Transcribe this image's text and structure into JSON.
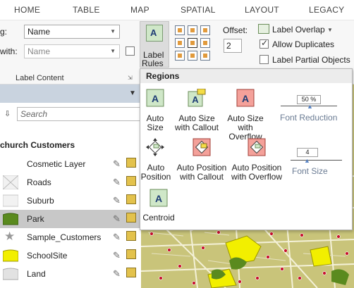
{
  "ribbon_tabs": [
    "HOME",
    "TABLE",
    "MAP",
    "SPATIAL",
    "LAYOUT",
    "LEGACY"
  ],
  "ribbon": {
    "label_using_label": "g:",
    "label_using_value": "Name",
    "label_with_label": "with:",
    "label_with_placeholder": "Name",
    "label_content_caption": "Label Content",
    "label_rules_line1": "Label",
    "label_rules_line2": "Rules",
    "offset_label": "Offset:",
    "offset_value": "2",
    "label_overlap": "Label Overlap",
    "allow_duplicates": "Allow Duplicates",
    "label_partial_objects": "Label Partial Objects",
    "allow_duplicates_checked": true,
    "label_partial_checked": false
  },
  "dropdown": {
    "header": "Regions",
    "items": [
      {
        "line1": "Auto",
        "line2": "Size"
      },
      {
        "line1": "Auto Size",
        "line2": "with Callout"
      },
      {
        "line1": "Auto Size",
        "line2": "with Overflow"
      },
      {
        "line1": "Auto",
        "line2": "Position"
      },
      {
        "line1": "Auto Position",
        "line2": "with Callout"
      },
      {
        "line1": "Auto Position",
        "line2": "with Overflow"
      },
      {
        "line1": "Centroid",
        "line2": ""
      }
    ],
    "font_reduction_label": "Font Reduction",
    "font_reduction_value": "50 %",
    "font_size_label": "Font Size",
    "font_size_value": "4"
  },
  "left_panel": {
    "search_placeholder": "Search",
    "group_title": "church Customers",
    "layers": [
      {
        "name": "Cosmetic Layer",
        "selected": false
      },
      {
        "name": "Roads",
        "selected": false
      },
      {
        "name": "Suburb",
        "selected": false
      },
      {
        "name": "Park",
        "selected": true
      },
      {
        "name": "Sample_Customers",
        "selected": false
      },
      {
        "name": "SchoolSite",
        "selected": false
      },
      {
        "name": "Land",
        "selected": false
      }
    ]
  },
  "colors": {
    "map_fill": "#c9c47a",
    "park_green": "#5a8a1e",
    "school_yellow": "#f2ef00",
    "customer_red": "#c8102e",
    "selected_row": "#c8c8c8",
    "panel_header": "#c9d3df"
  }
}
